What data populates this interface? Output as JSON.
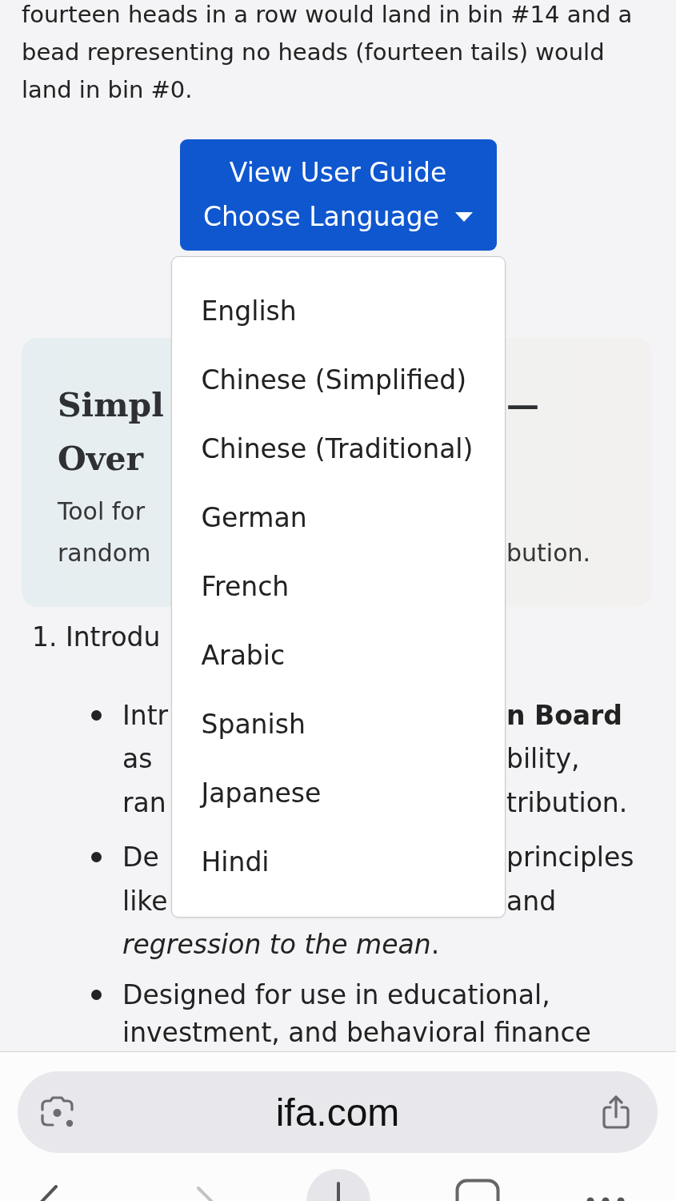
{
  "page": {
    "intro_paragraph": "fourteen heads in a row would land in bin #14 and a bead representing no heads (fourteen tails) would land in bin #0.",
    "guide_button": {
      "lines": [
        "View User Guide",
        "Choose Language"
      ],
      "expanded": true
    },
    "language_menu": {
      "items": [
        "English",
        "Chinese (Simplified)",
        "Chinese (Traditional)",
        "German",
        "French",
        "Arabic",
        "Spanish",
        "Japanese",
        "Hindi"
      ]
    },
    "overview_card": {
      "title_lines": [
        {
          "left": "Simpl",
          "right": "—"
        },
        {
          "left": "Over"
        }
      ],
      "subtitle_lines": [
        {
          "left": "Tool for"
        },
        {
          "left": "random",
          "right": "bution."
        }
      ]
    },
    "section_heading": {
      "left": "1. Introdu"
    },
    "bullets": [
      {
        "lines": [
          {
            "left": "Intr",
            "right": "n Board",
            "right_bold": true
          },
          {
            "left": "as",
            "right": "bility,",
            "right_bold": false
          },
          {
            "left": "ran",
            "right": "tribution.",
            "right_bold": false
          }
        ]
      },
      {
        "lines": [
          {
            "left": "De",
            "right": "principles",
            "right_bold": false
          },
          {
            "left": "like",
            "right": "and",
            "right_bold": false
          },
          {
            "full": "*regression to the mean*."
          }
        ]
      },
      {
        "lines": [
          {
            "full": "Designed for use in educational, investment, and behavioral finance"
          }
        ]
      }
    ]
  },
  "browser_bar": {
    "address": "ifa.com"
  }
}
